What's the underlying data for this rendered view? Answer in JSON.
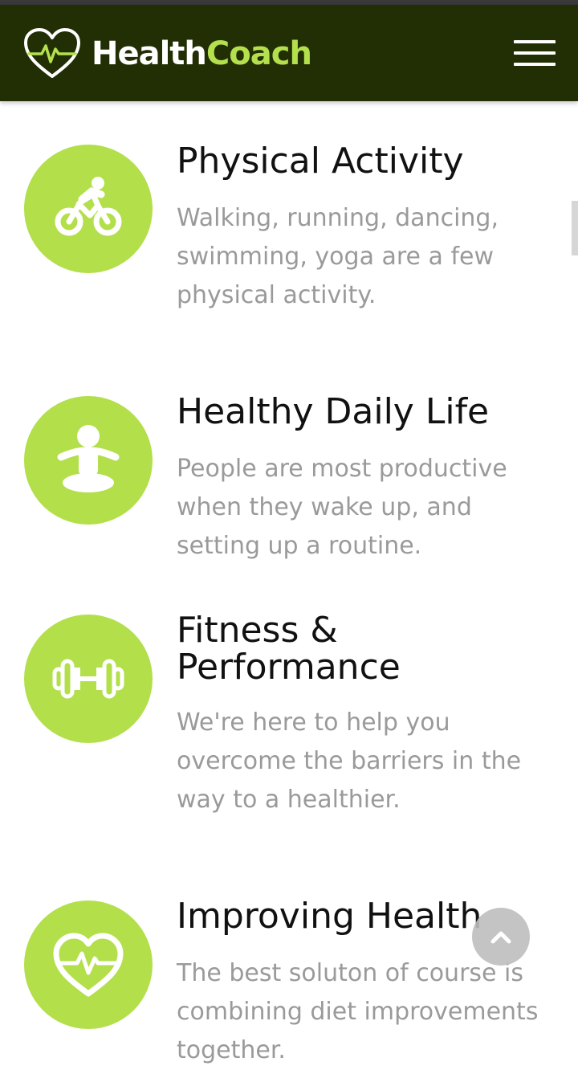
{
  "header": {
    "brand_part1": "Health",
    "brand_part2": "Coach",
    "logo_icon": "heart-pulse-icon",
    "menu_icon": "hamburger-icon"
  },
  "features": [
    {
      "icon": "bicycle-icon",
      "title": "Physical Activity",
      "description": "Walking, running, dancing, swimming, yoga are a few physical activity."
    },
    {
      "icon": "meditation-icon",
      "title": "Healthy Daily Life",
      "description": "People are most productive when they wake up, and setting up a routine."
    },
    {
      "icon": "dumbbell-icon",
      "title": "Fitness & Performance",
      "description": "We're here to help you overcome the barriers in the way to a healthier."
    },
    {
      "icon": "heart-pulse-icon",
      "title": "Improving Health",
      "description": "The best soluton of course is combining diet improvements together."
    }
  ],
  "scroll_top": {
    "icon": "chevron-up-icon"
  },
  "colors": {
    "navbar": "#222e04",
    "accent": "#b3df4b",
    "brand_accent": "#b5e04e",
    "title": "#111111",
    "description": "#9a9a9a"
  }
}
